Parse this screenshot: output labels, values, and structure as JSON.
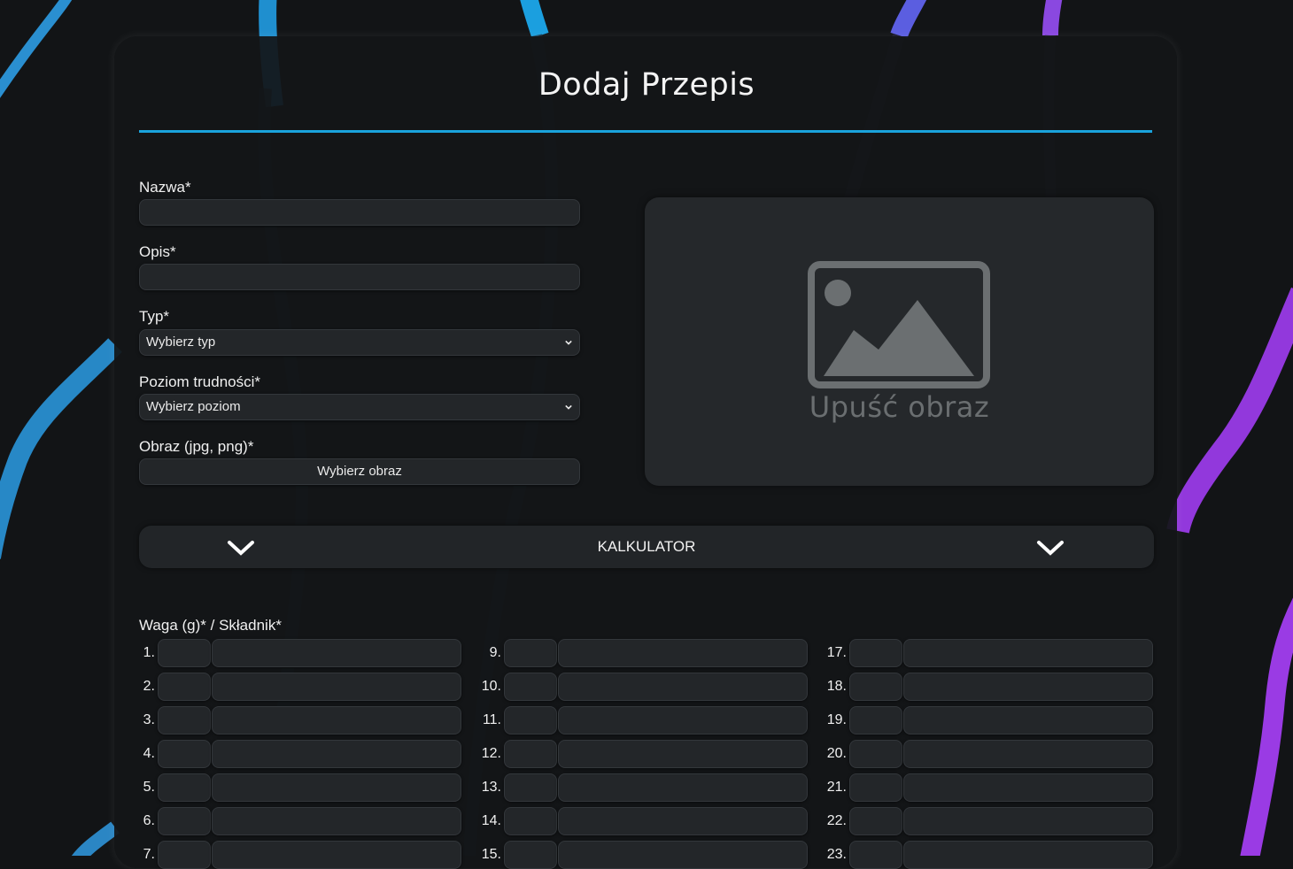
{
  "page": {
    "title": "Dodaj Przepis"
  },
  "form": {
    "name_label": "Nazwa*",
    "name_value": "",
    "description_label": "Opis*",
    "description_value": "",
    "type_label": "Typ*",
    "type_selected": "Wybierz typ",
    "difficulty_label": "Poziom trudności*",
    "difficulty_selected": "Wybierz poziom",
    "image_label": "Obraz (jpg, png)*",
    "image_button": "Wybierz obraz"
  },
  "dropzone": {
    "text": "Upuść obraz",
    "icon": "image-placeholder-icon"
  },
  "calculator": {
    "label": "KALKULATOR",
    "icon": "chevron-down-icon"
  },
  "ingredients": {
    "label": "Waga (g)* / Składnik*",
    "columns": [
      [
        "1.",
        "2.",
        "3.",
        "4.",
        "5.",
        "6.",
        "7."
      ],
      [
        "9.",
        "10.",
        "11.",
        "12.",
        "13.",
        "14.",
        "15."
      ],
      [
        "17.",
        "18.",
        "19.",
        "20.",
        "21.",
        "22.",
        "23."
      ]
    ]
  },
  "colors": {
    "accent": "#1aa3dc",
    "background": "#121416",
    "card": "#131518",
    "field": "#232629",
    "stripe_blue": "#2a8fd0",
    "stripe_purple": "#9b3ee0"
  }
}
